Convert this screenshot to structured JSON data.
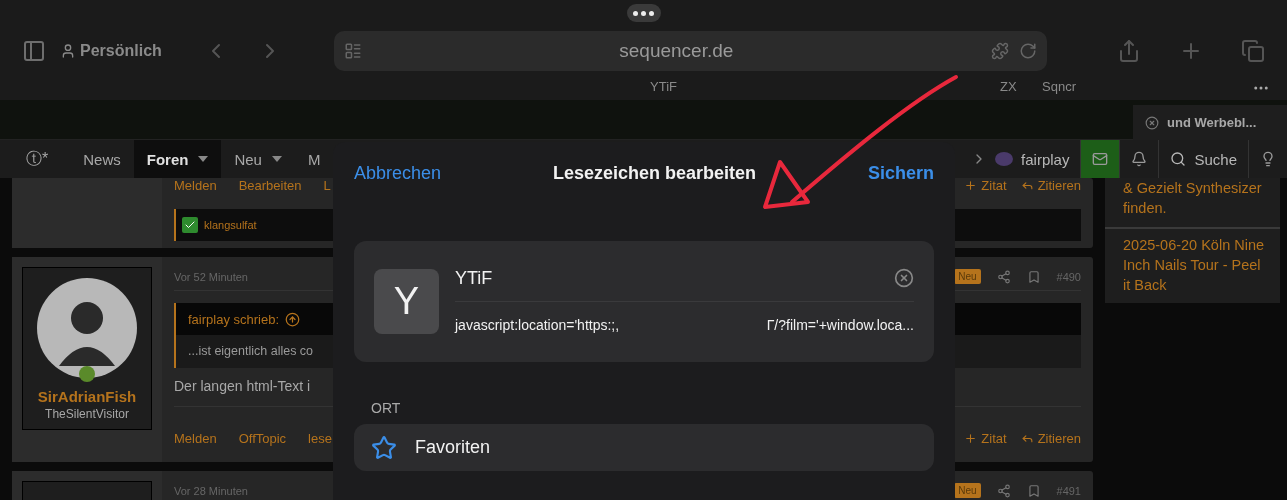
{
  "browser": {
    "profile": "Persönlich",
    "address": "sequencer.de",
    "bookmarks": [
      {
        "label": "YTiF"
      },
      {
        "label": "ZX"
      },
      {
        "label": "Sqncr"
      }
    ],
    "tab": {
      "title": "und Werbebl..."
    }
  },
  "forum_nav": {
    "logo": "ⓣ*",
    "items": [
      {
        "label": "News",
        "selected": false,
        "dropdown": false
      },
      {
        "label": "Foren",
        "selected": true,
        "dropdown": true
      },
      {
        "label": "Neu",
        "selected": false,
        "dropdown": true
      },
      {
        "label": "M",
        "selected": false,
        "dropdown": false
      }
    ],
    "user": "fairplay",
    "search": "Suche"
  },
  "posts": [
    {
      "actions_left": [
        "Melden",
        "Bearbeiten",
        "L"
      ],
      "actions_right": [
        "Zitat",
        "Zitieren"
      ],
      "reaction": "klangsulfat"
    },
    {
      "time": "Vor 52 Minuten",
      "badge": "Neu",
      "number": "#490",
      "author": "SirAdrianFish",
      "user_title": "TheSilentVisitor",
      "quote_author": "fairplay schrieb:",
      "quote_text": "...ist eigentlich alles co",
      "body": "Der langen html-Text i",
      "actions_left": [
        "Melden",
        "OffTopic",
        "lese"
      ],
      "actions_right": [
        "Zitat",
        "Zitieren"
      ]
    },
    {
      "time": "Vor 28 Minuten",
      "badge": "Neu",
      "number": "#491"
    }
  ],
  "sidebar": [
    "& Gezielt Synthesizer finden.",
    "2025-06-20 Köln Nine Inch Nails Tour - Peel it Back"
  ],
  "dialog": {
    "cancel": "Abbrechen",
    "title": "Lesezeichen bearbeiten",
    "save": "Sichern",
    "icon_letter": "Y",
    "name": "YTiF",
    "address_start": "javascript:location='https:;,",
    "address_end": "Γ/?film='+window.loca...",
    "section": "ORT",
    "location": "Favoriten"
  }
}
